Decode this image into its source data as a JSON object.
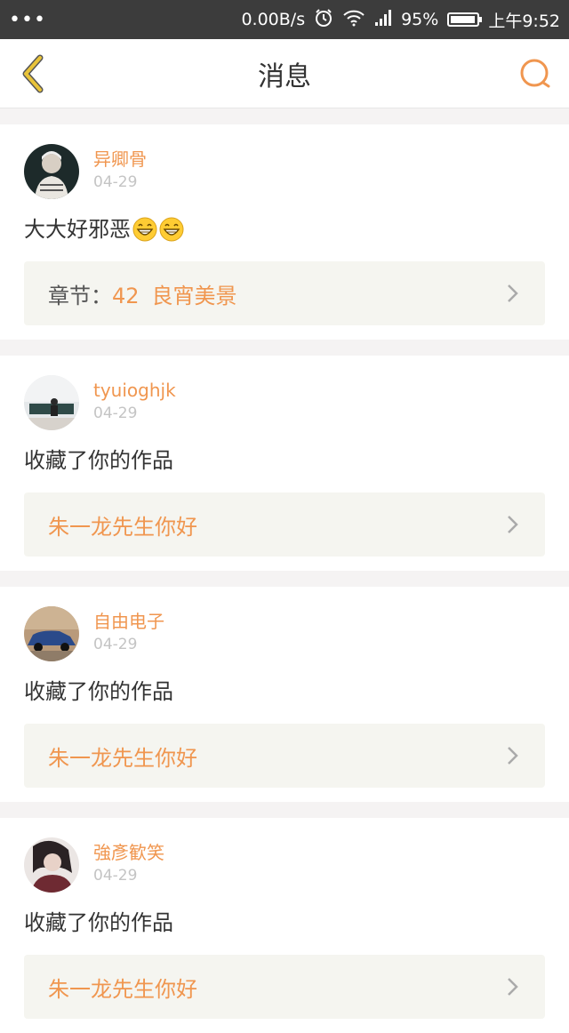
{
  "statusbar": {
    "dots": "•••",
    "speed": "0.00B/s",
    "battery": "95%",
    "time": "上午9:52"
  },
  "header": {
    "title": "消息",
    "back_icon": "chevron-left-icon",
    "search_icon": "search-icon"
  },
  "colors": {
    "accent": "#f0964f",
    "back": "#e8c33a"
  },
  "messages": [
    {
      "username": "异卿骨",
      "date": "04-29",
      "text": "大大好邪恶",
      "emoji_count": 2,
      "link_prefix": "章节：",
      "link_number": "42",
      "link_title": "良宵美景"
    },
    {
      "username": "tyuioghjk",
      "date": "04-29",
      "text": "收藏了你的作品",
      "link_title": "朱一龙先生你好"
    },
    {
      "username": "自由电子",
      "date": "04-29",
      "text": "收藏了你的作品",
      "link_title": "朱一龙先生你好"
    },
    {
      "username": "強彥歓笑",
      "date": "04-29",
      "text": "收藏了你的作品",
      "link_title": "朱一龙先生你好"
    }
  ]
}
